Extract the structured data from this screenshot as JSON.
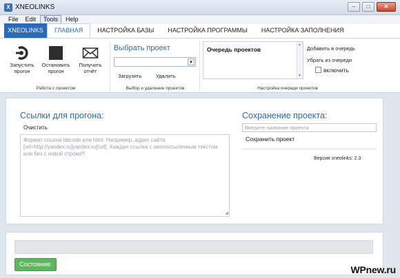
{
  "window": {
    "title": "XNEOLINKS",
    "icon": "x-logo-icon"
  },
  "menu": [
    "File",
    "Edit",
    "Tools",
    "Help"
  ],
  "tabs": {
    "app": "XNEOLINKS",
    "items": [
      "ГЛАВНАЯ",
      "НАСТРОЙКА БАЗЫ",
      "НАСТРОЙКА ПРОГРАММЫ",
      "НАСТРОЙКА ЗАПОЛНЕНИЯ"
    ],
    "active": "ГЛАВНАЯ"
  },
  "ribbon": {
    "run_group": {
      "start": "Запустить прогон",
      "stop": "Остановить прогон",
      "report": "Получить отчёт",
      "label": "Работа с проектом"
    },
    "project_group": {
      "title": "Выбрать проект",
      "selected": "",
      "load": "Загрузить",
      "delete": "Удалить",
      "label": "Выбор и удаление проектов"
    },
    "queue_group": {
      "list_title": "Очередь проектов",
      "add": "Добавить в очередь",
      "remove": "Убрать из очереди",
      "enable": "включить",
      "enable_checked": false,
      "label": "Настройка очереди проектов"
    }
  },
  "links": {
    "title": "Ссылки для прогона:",
    "clear": "Очистить",
    "placeholder": "Формат ссылок bbcode или html. Например, адрес сайта [url=http://yandex.ru]yandex.ru[/url]. Каждая ссылка с окопоссылочным текстом или без с новой строки!!!"
  },
  "save": {
    "title": "Сохранение проекта:",
    "input_placeholder": "Введите название проекта",
    "input_value": "",
    "button": "Сохранить проект",
    "version": "Версия xneolinks: 2.3"
  },
  "status": {
    "progress": 0,
    "label": "Состояние:"
  },
  "watermark": "WPnew.ru",
  "colors": {
    "accent": "#2a6ab8",
    "success": "#5cb85c"
  }
}
